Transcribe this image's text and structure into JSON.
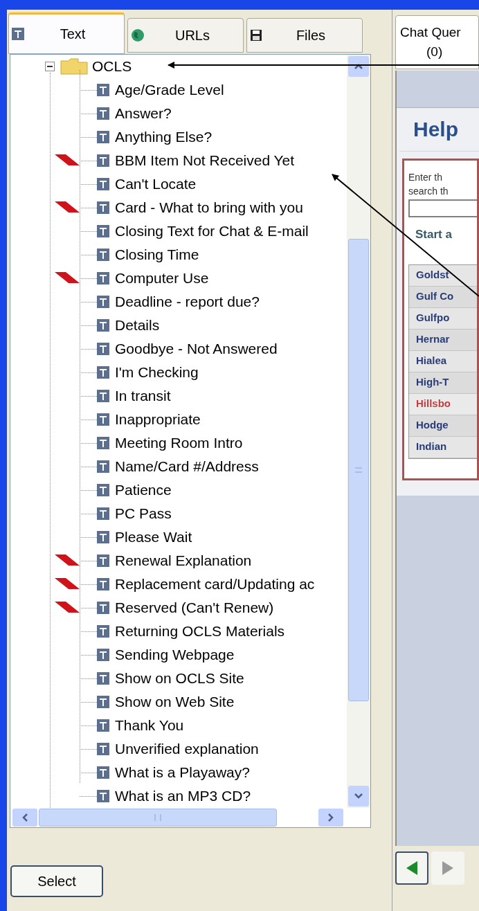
{
  "tabs": [
    {
      "label": "Text",
      "kind": "text",
      "selected": true
    },
    {
      "label": "URLs",
      "kind": "globe",
      "selected": false
    },
    {
      "label": "Files",
      "kind": "disk",
      "selected": false
    }
  ],
  "tree": {
    "label": "OCLS",
    "expanded": true,
    "children": [
      {
        "label": "Age/Grade Level",
        "flagged": false
      },
      {
        "label": "Answer?",
        "flagged": false
      },
      {
        "label": "Anything Else?",
        "flagged": false
      },
      {
        "label": "BBM Item Not Received Yet",
        "flagged": true
      },
      {
        "label": "Can't Locate",
        "flagged": false
      },
      {
        "label": "Card - What to bring with you",
        "flagged": true
      },
      {
        "label": "Closing Text for Chat & E-mail",
        "flagged": false
      },
      {
        "label": "Closing Time",
        "flagged": false
      },
      {
        "label": "Computer Use",
        "flagged": true
      },
      {
        "label": "Deadline - report due?",
        "flagged": false
      },
      {
        "label": "Details",
        "flagged": false
      },
      {
        "label": "Goodbye - Not Answered",
        "flagged": false
      },
      {
        "label": "I'm Checking",
        "flagged": false
      },
      {
        "label": "In transit",
        "flagged": false
      },
      {
        "label": "Inappropriate",
        "flagged": false
      },
      {
        "label": "Meeting Room Intro",
        "flagged": false
      },
      {
        "label": "Name/Card #/Address",
        "flagged": false
      },
      {
        "label": "Patience",
        "flagged": false
      },
      {
        "label": "PC Pass",
        "flagged": false
      },
      {
        "label": "Please Wait",
        "flagged": false
      },
      {
        "label": "Renewal Explanation",
        "flagged": true
      },
      {
        "label": "Replacement card/Updating ac",
        "flagged": true
      },
      {
        "label": "Reserved (Can't Renew)",
        "flagged": true
      },
      {
        "label": "Returning OCLS Materials",
        "flagged": false
      },
      {
        "label": "Sending Webpage",
        "flagged": false
      },
      {
        "label": "Show on OCLS Site",
        "flagged": false
      },
      {
        "label": "Show on Web Site",
        "flagged": false
      },
      {
        "label": "Thank You",
        "flagged": false
      },
      {
        "label": "Unverified explanation",
        "flagged": false
      },
      {
        "label": "What is a Playaway?",
        "flagged": false
      },
      {
        "label": "What is an MP3 CD?",
        "flagged": false
      }
    ]
  },
  "select_button": "Select",
  "chat_queue_tab": {
    "label": "Chat Quer",
    "count": "(0)"
  },
  "heading": "Help",
  "search_instructions": [
    "Enter th",
    "search th"
  ],
  "start_link": "Start a",
  "libraries": [
    {
      "name": "Goldst",
      "highlighted": false
    },
    {
      "name": "Gulf Co",
      "highlighted": false
    },
    {
      "name": "Gulfpo",
      "highlighted": false
    },
    {
      "name": "Hernar",
      "highlighted": false
    },
    {
      "name": "Hialea",
      "highlighted": false
    },
    {
      "name": "High-T",
      "highlighted": false
    },
    {
      "name": "Hillsbo",
      "highlighted": true
    },
    {
      "name": "Hodge",
      "highlighted": false
    },
    {
      "name": "Indian",
      "highlighted": false
    }
  ]
}
